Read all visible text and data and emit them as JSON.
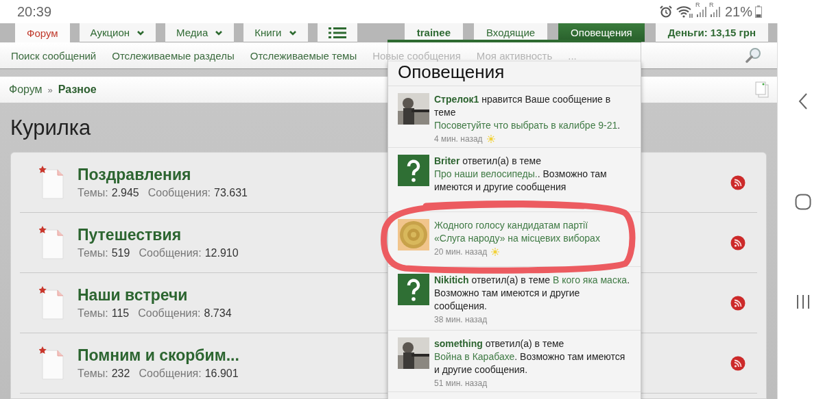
{
  "status_bar": {
    "time": "20:39",
    "sim_labels": [
      "R",
      "R"
    ],
    "battery": "21%"
  },
  "nav_tabs": [
    {
      "kind": "text",
      "label": "Форум",
      "selected": true,
      "dropdown": false
    },
    {
      "kind": "text",
      "label": "Аукцион",
      "selected": false,
      "dropdown": true
    },
    {
      "kind": "text",
      "label": "Медиа",
      "selected": false,
      "dropdown": true
    },
    {
      "kind": "text",
      "label": "Книги",
      "selected": false,
      "dropdown": true
    },
    {
      "kind": "menu",
      "selected": false,
      "dropdown": false
    }
  ],
  "account_tabs": [
    {
      "label": "trainee",
      "selected": false,
      "strong": true
    },
    {
      "label": "Входящие",
      "selected": false,
      "strong": false
    },
    {
      "label": "Оповещения",
      "selected": true,
      "strong": false
    },
    {
      "label": "Деньги: 13,15 грн",
      "selected": false,
      "strong": true
    }
  ],
  "sub_nav": [
    {
      "label": "Поиск сообщений",
      "faded": false
    },
    {
      "label": "Отслеживаемые разделы",
      "faded": false
    },
    {
      "label": "Отслеживаемые темы",
      "faded": false
    },
    {
      "label": "Новые сообщения",
      "faded": true
    },
    {
      "label": "Моя активность",
      "faded": true
    },
    {
      "label": "...",
      "faded": true
    }
  ],
  "breadcrumb": [
    {
      "label": "Форум",
      "current": false
    },
    {
      "label": "Разное",
      "current": true
    }
  ],
  "breadcrumb_separator": "»",
  "page_title": "Курилка",
  "forums": [
    {
      "title": "Поздравления",
      "topics_label": "Темы:",
      "topics": "2.945",
      "messages_label": "Сообщения:",
      "messages": "73.631"
    },
    {
      "title": "Путешествия",
      "topics_label": "Темы:",
      "topics": "519",
      "messages_label": "Сообщения:",
      "messages": "12.910"
    },
    {
      "title": "Наши встречи",
      "topics_label": "Темы:",
      "topics": "115",
      "messages_label": "Сообщения:",
      "messages": "8.734"
    },
    {
      "title": "Помним и скорбим...",
      "topics_label": "Темы:",
      "topics": "232",
      "messages_label": "Сообщения:",
      "messages": "16.901"
    }
  ],
  "notifications": {
    "title": "Оповещения",
    "items": [
      {
        "parts": [
          {
            "kind": "user",
            "text": "Стрелок1"
          },
          {
            "kind": "plain",
            "text": " нравится Ваше сообщение в теме "
          },
          {
            "kind": "link",
            "text": "Посоветуйте что выбрать в калибре 9-21"
          },
          {
            "kind": "plain",
            "text": "."
          }
        ],
        "time": "4 мин. назад",
        "new": true
      },
      {
        "kind": "question",
        "parts": [
          {
            "kind": "user",
            "text": "Briter"
          },
          {
            "kind": "plain",
            "text": " ответил(а) в теме "
          },
          {
            "kind": "link",
            "text": "Про наши велосипеды."
          },
          {
            "kind": "plain",
            "text": ". Возможно там имеются и другие сообщения"
          }
        ],
        "new": false
      },
      {
        "kind": "coin",
        "parts": [
          {
            "kind": "link",
            "text": "Жодного голосу кандидатам партії «Слуга народу» на місцевих виборах"
          }
        ],
        "time": "20 мин. назад",
        "new": true
      },
      {
        "kind": "question",
        "parts": [
          {
            "kind": "user",
            "text": "Nikitich"
          },
          {
            "kind": "plain",
            "text": " ответил(а) в теме "
          },
          {
            "kind": "link",
            "text": "В кого яка маска"
          },
          {
            "kind": "plain",
            "text": ". Возможно там имеются и другие сообщения."
          }
        ],
        "time": "38 мин. назад",
        "new": false
      },
      {
        "parts": [
          {
            "kind": "user",
            "text": "something"
          },
          {
            "kind": "plain",
            "text": " ответил(а) в теме "
          },
          {
            "kind": "link",
            "text": "Война в Карабахе"
          },
          {
            "kind": "plain",
            "text": ". Возможно там имеются и другие сообщения."
          }
        ],
        "time": "51 мин. назад",
        "new": false
      }
    ]
  },
  "annotation": {
    "kind": "circle",
    "color": "#ec5b60"
  }
}
